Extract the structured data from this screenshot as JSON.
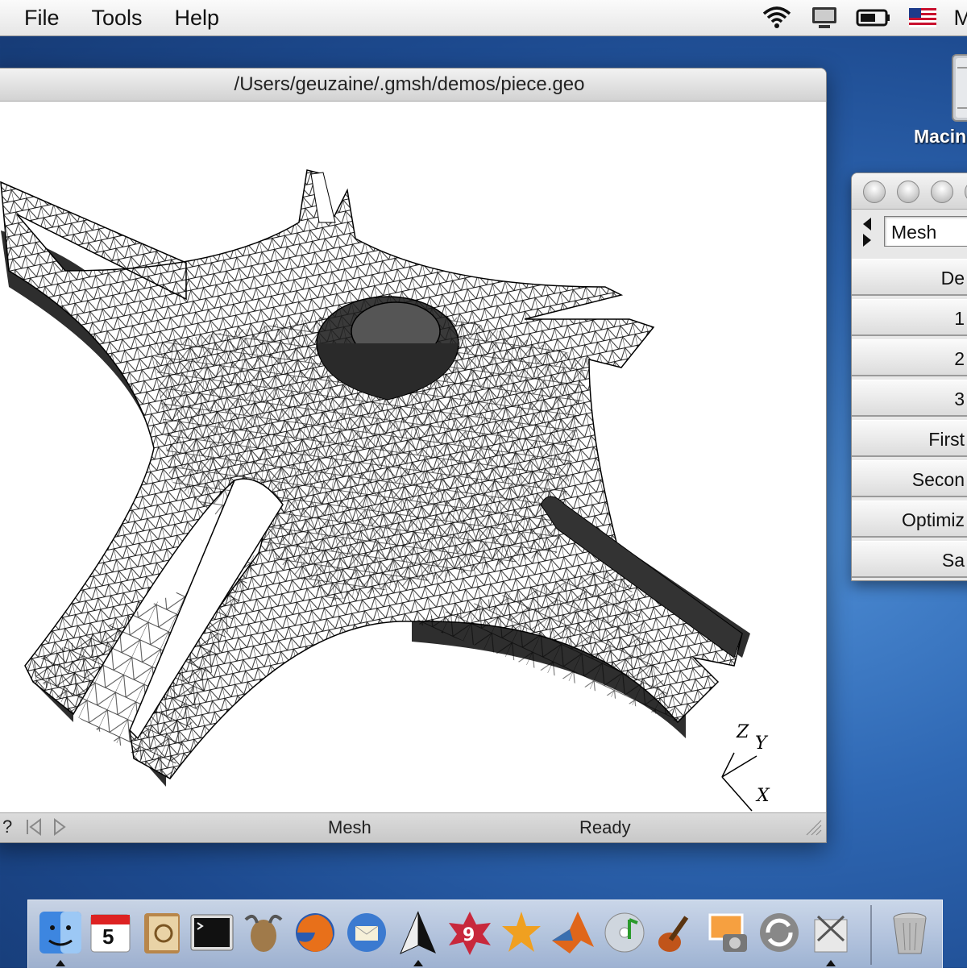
{
  "menubar": {
    "items": [
      "File",
      "Tools",
      "Help"
    ],
    "user_initial": "M"
  },
  "window": {
    "title": "/Users/geuzaine/.gmsh/demos/piece.geo",
    "status": {
      "help": "?",
      "mode": "Mesh",
      "state": "Ready"
    },
    "axes": {
      "z": "Z",
      "y": "Y",
      "x": "X"
    }
  },
  "desktop": {
    "hd_label": "Macin"
  },
  "panel": {
    "module": "Mesh",
    "buttons": [
      "De",
      "1",
      "2",
      "3",
      "First",
      "Secon",
      "Optimiz",
      "Sa"
    ]
  },
  "dock": {
    "calendar_day": "5",
    "icons": [
      "finder-icon",
      "ical-icon",
      "address-book-icon",
      "terminal-icon",
      "gnu-icon",
      "firefox-icon",
      "thunderbird-icon",
      "gmsh-icon",
      "app-9-icon",
      "maple-icon",
      "matlab-icon",
      "itunes-icon",
      "garageband-icon",
      "iphoto-icon",
      "sync-icon",
      "utility-icon",
      "trash-icon"
    ]
  },
  "colors": {
    "mesh_line": "#000000",
    "mesh_face": "#ffffff",
    "mesh_side": "#2e2e2e",
    "desktop": "#2f68b4"
  }
}
